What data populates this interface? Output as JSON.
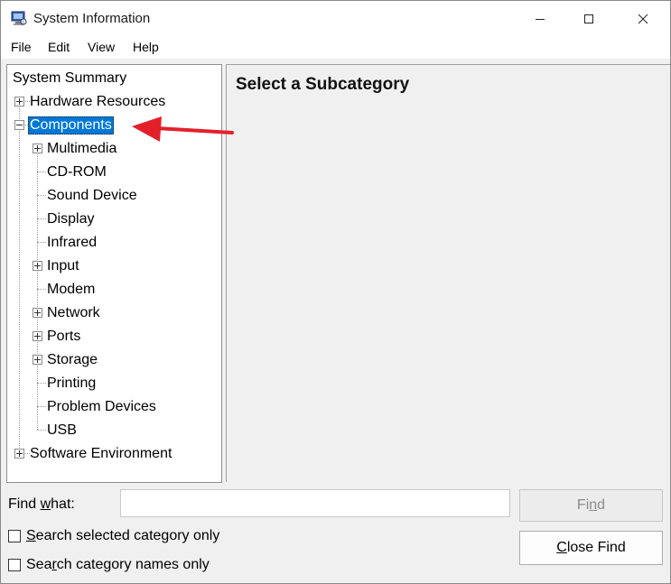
{
  "window": {
    "title": "System Information",
    "controls": {
      "minimize": "minimize",
      "maximize": "maximize",
      "close": "close"
    }
  },
  "menu": [
    "File",
    "Edit",
    "View",
    "Help"
  ],
  "tree": {
    "items": [
      "System Summary",
      "Hardware Resources",
      "Components",
      "Multimedia",
      "CD-ROM",
      "Sound Device",
      "Display",
      "Infrared",
      "Input",
      "Modem",
      "Network",
      "Ports",
      "Storage",
      "Printing",
      "Problem Devices",
      "USB",
      "Software Environment"
    ],
    "selected": "Components"
  },
  "detail": {
    "heading": "Select a Subcategory"
  },
  "find": {
    "label_pre": "Find ",
    "label_hotkey": "w",
    "label_post": "hat:",
    "value": "",
    "find_pre": "Fi",
    "find_hotkey": "n",
    "find_post": "d",
    "close_hotkey": "C",
    "close_post": "lose Find",
    "opt1_hotkey": "S",
    "opt1_post": "earch selected category only",
    "opt2_pre": "Sea",
    "opt2_hotkey": "r",
    "opt2_post": "ch category names only"
  },
  "icons": {
    "app": "system-information-icon",
    "annotation": "red-arrow-pointing-left"
  },
  "colors": {
    "selection": "#0078d7",
    "arrow": "#e3202a"
  }
}
